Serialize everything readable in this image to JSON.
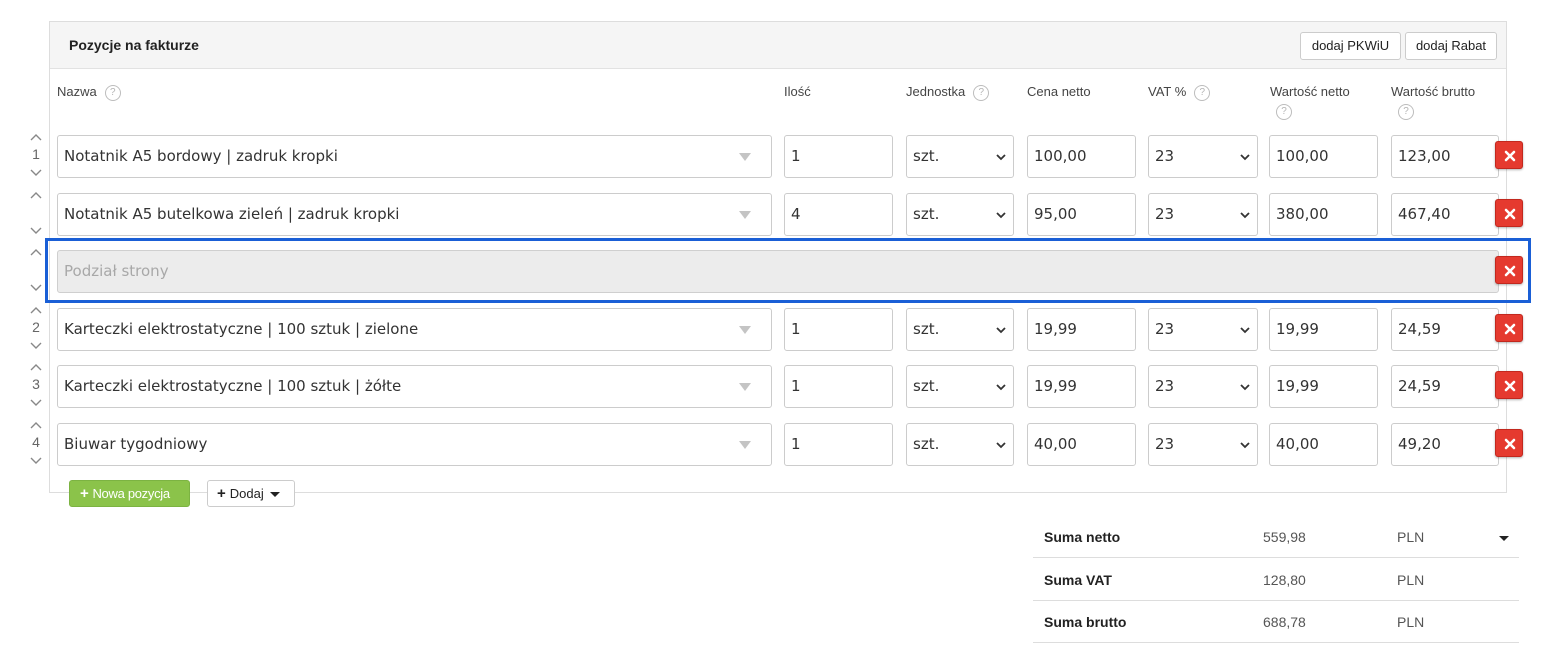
{
  "panel": {
    "title": "Pozycje na fakturze",
    "add_pkwiu_label": "dodaj PKWiU",
    "add_discount_label": "dodaj Rabat"
  },
  "columns": {
    "name": "Nazwa",
    "qty": "Ilość",
    "unit": "Jednostka",
    "price_net": "Cena netto",
    "vat": "VAT %",
    "value_net": "Wartość netto",
    "value_gross": "Wartość brutto"
  },
  "help_glyph": "?",
  "rows": [
    {
      "num": "1",
      "name": "Notatnik A5 bordowy | zadruk kropki",
      "qty": "1",
      "unit": "szt.",
      "price": "100,00",
      "vat": "23",
      "net": "100,00",
      "gross": "123,00"
    },
    {
      "num": "",
      "name": "Notatnik A5 butelkowa zieleń | zadruk kropki",
      "qty": "4",
      "unit": "szt.",
      "price": "95,00",
      "vat": "23",
      "net": "380,00",
      "gross": "467,40"
    },
    {
      "num": "2",
      "name": "Karteczki elektrostatyczne | 100 sztuk | zielone",
      "qty": "1",
      "unit": "szt.",
      "price": "19,99",
      "vat": "23",
      "net": "19,99",
      "gross": "24,59"
    },
    {
      "num": "3",
      "name": "Karteczki elektrostatyczne | 100 sztuk | żółte",
      "qty": "1",
      "unit": "szt.",
      "price": "19,99",
      "vat": "23",
      "net": "19,99",
      "gross": "24,59"
    },
    {
      "num": "4",
      "name": "Biuwar tygodniowy",
      "qty": "1",
      "unit": "szt.",
      "price": "40,00",
      "vat": "23",
      "net": "40,00",
      "gross": "49,20"
    }
  ],
  "page_break": {
    "label": "Podział strony"
  },
  "actions": {
    "new_item_label": "Nowa pozycja",
    "add_label": "Dodaj"
  },
  "totals": [
    {
      "label": "Suma netto",
      "value": "559,98",
      "currency": "PLN"
    },
    {
      "label": "Suma VAT",
      "value": "128,80",
      "currency": "PLN"
    },
    {
      "label": "Suma brutto",
      "value": "688,78",
      "currency": "PLN"
    }
  ],
  "colors": {
    "accent_green": "#8bc34a",
    "delete_red": "#e53a2f",
    "highlight_blue": "#1a5fd6"
  }
}
